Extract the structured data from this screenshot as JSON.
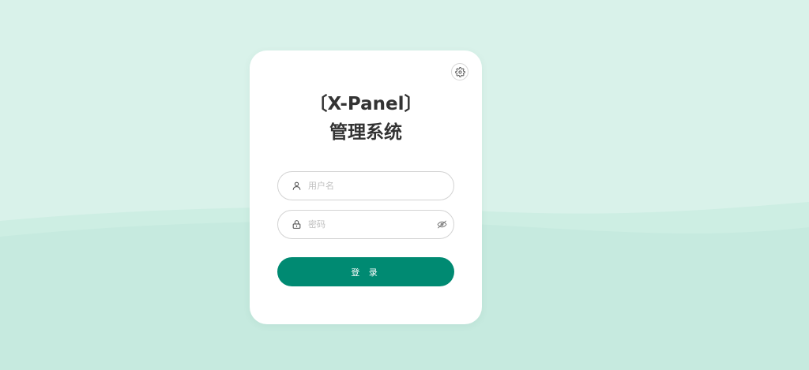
{
  "app": {
    "title_line1": "〔X-Panel〕",
    "title_line2": "管理系统"
  },
  "form": {
    "username_placeholder": "用户名",
    "username_value": "",
    "password_placeholder": "密码",
    "password_value": "",
    "login_label": "登 录"
  },
  "icons": {
    "settings": "gear-icon",
    "username": "user-icon",
    "password": "lock-icon",
    "toggle_visibility": "eye-off-icon"
  },
  "colors": {
    "background": "#d9f2ea",
    "wave": "#c6eadf",
    "primary": "#008a72",
    "card": "#ffffff",
    "title": "#333333"
  }
}
